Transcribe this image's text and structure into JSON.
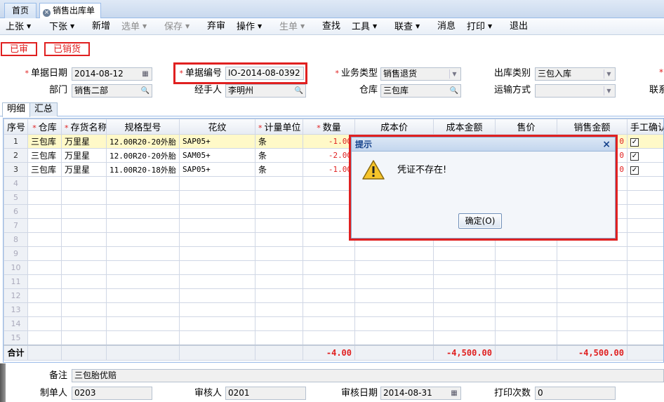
{
  "tabs": [
    {
      "label": "首页",
      "active": false
    },
    {
      "label": "销售出库单",
      "active": true
    }
  ],
  "menu": [
    {
      "label": "上张",
      "dropdown": true,
      "disabled": false
    },
    {
      "label": "下张",
      "dropdown": true,
      "disabled": false
    },
    {
      "label": "新增",
      "dropdown": false,
      "disabled": false
    },
    {
      "label": "选单",
      "dropdown": true,
      "disabled": true
    },
    {
      "label": "保存",
      "dropdown": true,
      "disabled": true
    },
    {
      "label": "弃审",
      "dropdown": false,
      "disabled": false
    },
    {
      "label": "操作",
      "dropdown": true,
      "disabled": false
    },
    {
      "label": "生单",
      "dropdown": true,
      "disabled": true
    },
    {
      "label": "查找",
      "dropdown": false,
      "disabled": false
    },
    {
      "label": "工具",
      "dropdown": true,
      "disabled": false
    },
    {
      "label": "联查",
      "dropdown": true,
      "disabled": false
    },
    {
      "label": "消息",
      "dropdown": false,
      "disabled": false
    },
    {
      "label": "打印",
      "dropdown": true,
      "disabled": false
    },
    {
      "label": "退出",
      "dropdown": false,
      "disabled": false
    }
  ],
  "status": {
    "audited": "已审",
    "sold": "已销货"
  },
  "header": {
    "date_label": "单据日期",
    "date_value": "2014-08-12",
    "no_label": "单据编号",
    "no_value": "IO-2014-08-0392",
    "biztype_label": "业务类型",
    "biztype_value": "销售退货",
    "outtype_label": "出库类别",
    "outtype_value": "三包入库",
    "dept_label": "部门",
    "dept_value": "销售二部",
    "handler_label": "经手人",
    "handler_value": "李明州",
    "warehouse_label": "仓库",
    "warehouse_value": "三包库",
    "transport_label": "运输方式",
    "transport_value": "",
    "contact_label": "联系"
  },
  "subtabs": {
    "detail": "明细",
    "summary": "汇总"
  },
  "grid": {
    "columns": [
      "序号",
      "仓库",
      "存货名称",
      "规格型号",
      "花纹",
      "计量单位",
      "数量",
      "成本价",
      "成本金额",
      "售价",
      "销售金额",
      "手工确认"
    ],
    "required": [
      false,
      true,
      true,
      false,
      false,
      true,
      true,
      false,
      false,
      false,
      false,
      false
    ],
    "rows": [
      {
        "no": "1",
        "wh": "三包库",
        "name": "万里星",
        "spec": "12.00R20-20外胎",
        "pattern": "SAP05+",
        "unit": "条",
        "qty": "-1.00",
        "sales_amt": "0",
        "confirmed": true
      },
      {
        "no": "2",
        "wh": "三包库",
        "name": "万里星",
        "spec": "12.00R20-20外胎",
        "pattern": "SAM05+",
        "unit": "条",
        "qty": "-2.00",
        "sales_amt": "0",
        "confirmed": true
      },
      {
        "no": "3",
        "wh": "三包库",
        "name": "万里星",
        "spec": "11.00R20-18外胎",
        "pattern": "SAP05+",
        "unit": "条",
        "qty": "-1.00",
        "sales_amt": "0",
        "confirmed": true
      }
    ],
    "empty_rows": [
      "4",
      "5",
      "6",
      "7",
      "8",
      "9",
      "10",
      "11",
      "12",
      "13",
      "14",
      "15"
    ],
    "total": {
      "label": "合计",
      "qty": "-4.00",
      "cost_amt": "-4,500.00",
      "sales_amt": "-4,500.00"
    }
  },
  "footer": {
    "remark_label": "备注",
    "remark_value": "三包胎优赔",
    "maker_label": "制单人",
    "maker_value": "0203",
    "auditor_label": "审核人",
    "auditor_value": "0201",
    "auditdate_label": "审核日期",
    "auditdate_value": "2014-08-31",
    "printcount_label": "打印次数",
    "printcount_value": "0"
  },
  "dialog": {
    "title": "提示",
    "message": "凭证不存在!",
    "ok": "确定(O)",
    "close": "×"
  },
  "icons": {
    "warning": "warning-icon",
    "calendar": "calendar-icon",
    "search": "magnifier-icon",
    "close": "close-icon"
  },
  "colors": {
    "required": "#e02020",
    "highlight_box": "#e02020",
    "selected_row": "#fff9c8"
  }
}
